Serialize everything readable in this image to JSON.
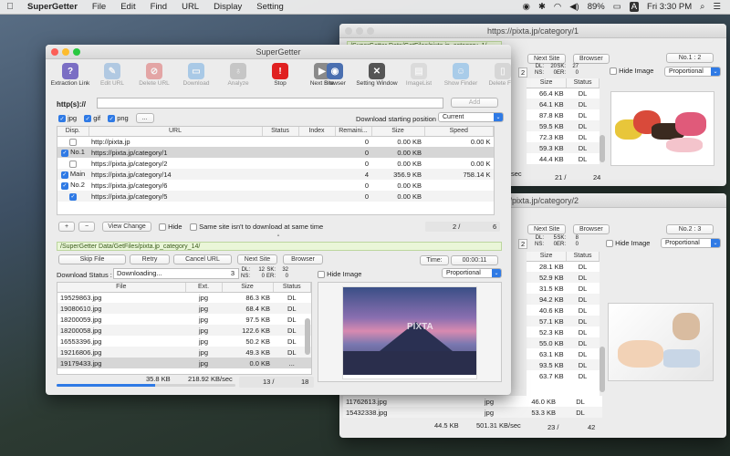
{
  "menubar": {
    "app": "SuperGetter",
    "items": [
      "File",
      "Edit",
      "Find",
      "URL",
      "Display",
      "Setting"
    ],
    "battery": "89%",
    "clock": "Fri 3:30 PM"
  },
  "main": {
    "title": "SuperGetter",
    "toolbar": [
      {
        "label": "Extraction Link",
        "icon": "extraction-link-icon",
        "color": "#7b6ec4",
        "glyph": "?",
        "dim": false
      },
      {
        "label": "Edit URL",
        "icon": "edit-url-icon",
        "color": "#6aa0d8",
        "glyph": "✎",
        "dim": true
      },
      {
        "label": "Delete URL",
        "icon": "delete-url-icon",
        "color": "#d95050",
        "glyph": "⊘",
        "dim": true
      },
      {
        "label": "Download",
        "icon": "download-icon",
        "color": "#5aa0e0",
        "glyph": "▭",
        "dim": true
      },
      {
        "label": "Analyze",
        "icon": "analyze-icon",
        "color": "#9a9a9a",
        "glyph": "♁",
        "dim": true
      },
      {
        "label": "Stop",
        "icon": "stop-icon",
        "color": "#e02020",
        "glyph": "!",
        "dim": false
      },
      {
        "label": "Next Site",
        "icon": "next-site-icon",
        "color": "#8a8a8a",
        "glyph": "▶",
        "dim": false
      }
    ],
    "toolbar_right": [
      {
        "label": "Browser",
        "icon": "browser-icon",
        "color": "#4a6fb0",
        "glyph": "◉",
        "dim": false
      },
      {
        "label": "Setting Window",
        "icon": "setting-window-icon",
        "color": "#555555",
        "glyph": "✕",
        "dim": false
      },
      {
        "label": "ImageList",
        "icon": "image-list-icon",
        "color": "#c8c8c8",
        "glyph": "▤",
        "dim": true
      },
      {
        "label": "Show Finder",
        "icon": "show-finder-icon",
        "color": "#5aa6e6",
        "glyph": "☺",
        "dim": true
      },
      {
        "label": "Delete File",
        "icon": "delete-file-icon",
        "color": "#bdbdbd",
        "glyph": "▯",
        "dim": true
      }
    ],
    "url_label": "http(s)://",
    "add_label": "Add",
    "filters": [
      {
        "label": "jpg",
        "on": true
      },
      {
        "label": "gif",
        "on": true
      },
      {
        "label": "png",
        "on": true
      }
    ],
    "more_label": "...",
    "start_pos_label": "Download starting position",
    "start_pos_value": "Current",
    "url_table": {
      "headers": [
        "Disp.",
        "URL",
        "Status",
        "Index",
        "Remaini...",
        "Size",
        "Speed"
      ],
      "rows": [
        {
          "checked": false,
          "disp": "",
          "url": "http://pixta.jp",
          "status": "",
          "index": "",
          "remain": "0",
          "size": "0.00 KB",
          "speed": "0.00 K"
        },
        {
          "checked": true,
          "disp": "No.1",
          "url": "https://pixta.jp/category/1",
          "status": "",
          "index": "",
          "remain": "0",
          "size": "0.00 KB",
          "speed": ""
        },
        {
          "checked": false,
          "disp": "",
          "url": "https://pixta.jp/category/2",
          "status": "",
          "index": "",
          "remain": "0",
          "size": "0.00 KB",
          "speed": "0.00 K"
        },
        {
          "checked": true,
          "disp": "Main",
          "url": "https://pixta.jp/category/14",
          "status": "",
          "index": "",
          "remain": "4",
          "size": "356.9 KB",
          "speed": "758.14 K"
        },
        {
          "checked": true,
          "disp": "No.2",
          "url": "https://pixta.jp/category/6",
          "status": "",
          "index": "",
          "remain": "0",
          "size": "0.00 KB",
          "speed": ""
        },
        {
          "checked": true,
          "disp": "",
          "url": "https://pixta.jp/category/5",
          "status": "",
          "index": "",
          "remain": "0",
          "size": "0.00 KB",
          "speed": ""
        }
      ]
    },
    "plus": "+",
    "minus": "−",
    "view_change": "View Change",
    "hide": "Hide",
    "same_site": "Same site isn't to download at same time",
    "count_left": "2 /",
    "count_right": "6",
    "path": "/SuperGetter Data/GetFiles/pixta.jp_category_14/",
    "skip_file": "Skip File",
    "retry": "Retry",
    "cancel_url": "Cancel URL",
    "next_site": "Next Site",
    "browser": "Browser",
    "time_label": "Time:",
    "time_value": "00:00:11",
    "dl_status_label": "Download Status :",
    "dl_status_value": "Downloading...",
    "dl_num": "3",
    "dl_stats": [
      "DL:",
      "12",
      "SK:",
      "32",
      "NS:",
      "0",
      "ER:",
      "0"
    ],
    "hide_image": "Hide Image",
    "proportional": "Proportional",
    "file_table": {
      "headers": [
        "File",
        "Ext.",
        "Size",
        "Status"
      ],
      "rows": [
        {
          "file": "19529863.jpg",
          "ext": "jpg",
          "size": "86.3 KB",
          "status": "DL"
        },
        {
          "file": "19080610.jpg",
          "ext": "jpg",
          "size": "68.4 KB",
          "status": "DL"
        },
        {
          "file": "18200059.jpg",
          "ext": "jpg",
          "size": "97.5 KB",
          "status": "DL"
        },
        {
          "file": "18200058.jpg",
          "ext": "jpg",
          "size": "122.6 KB",
          "status": "DL"
        },
        {
          "file": "16553396.jpg",
          "ext": "jpg",
          "size": "50.2 KB",
          "status": "DL"
        },
        {
          "file": "19216806.jpg",
          "ext": "jpg",
          "size": "49.3 KB",
          "status": "DL"
        },
        {
          "file": "19179433.jpg",
          "ext": "jpg",
          "size": "0.0 KB",
          "status": "..."
        }
      ]
    },
    "total_size": "35.8 KB",
    "speed": "218.92 KB/sec",
    "file_count_left": "13 /",
    "file_count_right": "18",
    "watermark": "PIXTA",
    "progress": 0.55
  },
  "win1": {
    "title": "https://pixta.jp/category/1",
    "path": "/SuperGetter Data/GetFiles/pixta.jp_category_1/",
    "next_site": "Next Site",
    "browser": "Browser",
    "badge": "No.1 : 2",
    "num": "2",
    "stats": [
      "DL:",
      "20",
      "SK:",
      "27",
      "NS:",
      "0",
      "ER:",
      "0"
    ],
    "hide_image": "Hide Image",
    "proportional": "Proportional",
    "headers": [
      "Size",
      "Status"
    ],
    "rows": [
      [
        "66.4 KB",
        "DL"
      ],
      [
        "64.1 KB",
        "DL"
      ],
      [
        "87.8 KB",
        "DL"
      ],
      [
        "59.5 KB",
        "DL"
      ],
      [
        "72.3 KB",
        "DL"
      ],
      [
        "59.3 KB",
        "DL"
      ],
      [
        "44.4 KB",
        "DL"
      ]
    ],
    "footer_speed": "sec",
    "count_left": "21 /",
    "count_right": "24"
  },
  "win2": {
    "title": "https://pixta.jp/category/2",
    "next_site": "Next Site",
    "browser": "Browser",
    "badge": "No.2 : 3",
    "num": "2",
    "stats": [
      "DL:",
      "5",
      "SK:",
      "8",
      "NS:",
      "0",
      "ER:",
      "0"
    ],
    "hide_image": "Hide Image",
    "proportional": "Proportional",
    "headers": [
      "Size",
      "Status"
    ],
    "rows": [
      [
        "28.1 KB",
        "DL"
      ],
      [
        "52.9 KB",
        "DL"
      ],
      [
        "31.5 KB",
        "DL"
      ],
      [
        "94.2 KB",
        "DL"
      ],
      [
        "40.6 KB",
        "DL"
      ],
      [
        "57.1 KB",
        "DL"
      ],
      [
        "52.3 KB",
        "DL"
      ],
      [
        "55.0 KB",
        "DL"
      ],
      [
        "63.1 KB",
        "DL"
      ],
      [
        "93.5 KB",
        "DL"
      ],
      [
        "63.7 KB",
        "DL"
      ]
    ],
    "extra_rows": [
      {
        "file": "11762613.jpg",
        "ext": "jpg",
        "size": "46.0 KB",
        "status": "DL"
      },
      {
        "file": "15432338.jpg",
        "ext": "jpg",
        "size": "53.3 KB",
        "status": "DL"
      }
    ],
    "total": "44.5 KB",
    "speed": "501.31 KB/sec",
    "count_left": "23 /",
    "count_right": "42"
  }
}
